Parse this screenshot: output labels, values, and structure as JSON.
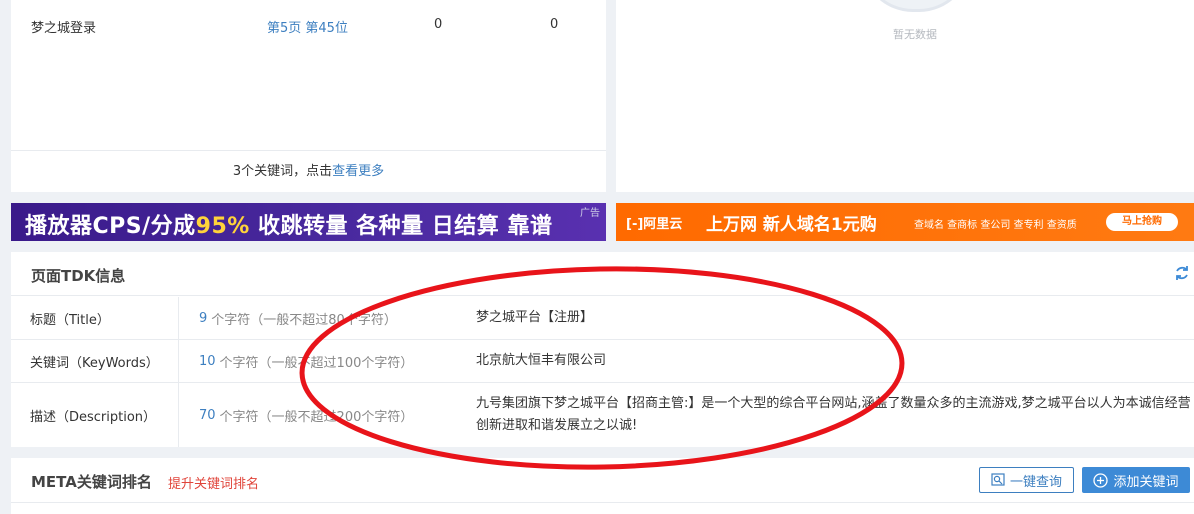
{
  "keyword_panel": {
    "row": {
      "name": "梦之城登录",
      "rank": "第5页 第45位",
      "val1": "0",
      "val2": "0"
    },
    "footer_prefix": "3个关键词，点击",
    "footer_link": "查看更多"
  },
  "empty_panel": {
    "text": "暂无数据"
  },
  "banner_left": {
    "text_a": "播放器CPS/分成",
    "text_b": "95%",
    "text_c": "  收跳转量 各种量 日结算 靠谱",
    "ad": "广告"
  },
  "banner_right": {
    "logo": "[-]阿里云",
    "main": "上万网  新人域名1元购",
    "sub": "查域名 查商标 查公司 查专利 查资质",
    "button": "马上抢购"
  },
  "tdk": {
    "title": "页面TDK信息",
    "rows": [
      {
        "label": "标题（Title）",
        "count": "9",
        "limit": "个字符（一般不超过80个字符）",
        "value": "梦之城平台【注册】"
      },
      {
        "label": "关键词（KeyWords）",
        "count": "10",
        "limit": "个字符（一般不超过100个字符）",
        "value": "北京航大恒丰有限公司"
      },
      {
        "label": "描述（Description）",
        "count": "70",
        "limit": "个字符（一般不超过200个字符）",
        "value": "九号集团旗下梦之城平台【招商主管:】是一个大型的综合平台网站,涵盖了数量众多的主流游戏,梦之城平台以人为本诚信经营创新进取和谐发展立之以诚!"
      }
    ]
  },
  "meta": {
    "title": "META关键词排名",
    "sub": "提升关键词排名",
    "query_button": "一键查询",
    "add_button": "添加关键词"
  },
  "colors": {
    "link": "#3d7fc0",
    "annotation": "#e8141a",
    "accent_red": "#e0443a"
  }
}
